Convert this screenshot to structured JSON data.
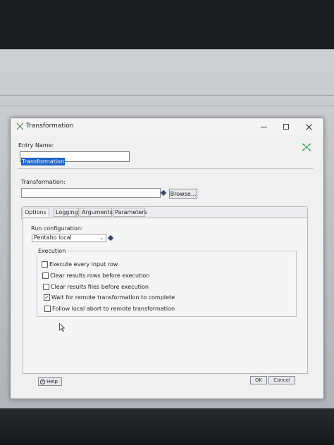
{
  "dialog": {
    "title": "Transformation",
    "entry_name_label": "Entry Name:",
    "entry_name_value": "Transformation",
    "transformation_label": "Transformation:",
    "transformation_value": "",
    "browse_label": "Browse...",
    "tabs": [
      {
        "label": "Options",
        "active": true
      },
      {
        "label": "Logging",
        "active": false
      },
      {
        "label": "Arguments",
        "active": false
      },
      {
        "label": "Parameters",
        "active": false
      }
    ],
    "run_configuration_label": "Run configuration:",
    "run_configuration_value": "Pentaho local",
    "execution_label": "Execution",
    "options": [
      {
        "label": "Execute every input row",
        "checked": false
      },
      {
        "label": "Clear results rows before execution",
        "checked": false
      },
      {
        "label": "Clear results files before execution",
        "checked": false
      },
      {
        "label": "Wait for remote transformation to complete",
        "checked": true
      },
      {
        "label": "Follow local abort to remote transformation",
        "checked": false
      }
    ],
    "help_label": "Help",
    "ok_label": "OK",
    "cancel_label": "Cancel"
  },
  "icons": {
    "app": "transformation-icon",
    "minimize": "minimize-icon",
    "maximize": "maximize-icon",
    "close": "close-icon",
    "entry": "transformation-entry-icon",
    "variable": "variable-diamond-icon",
    "dropdown": "chevron-down-icon",
    "help": "help-icon",
    "cursor": "mouse-cursor-icon"
  },
  "colors": {
    "selection": "#1e64c8",
    "dialog_bg": "#f0f0f1",
    "accent_icon": "#3aa860"
  }
}
